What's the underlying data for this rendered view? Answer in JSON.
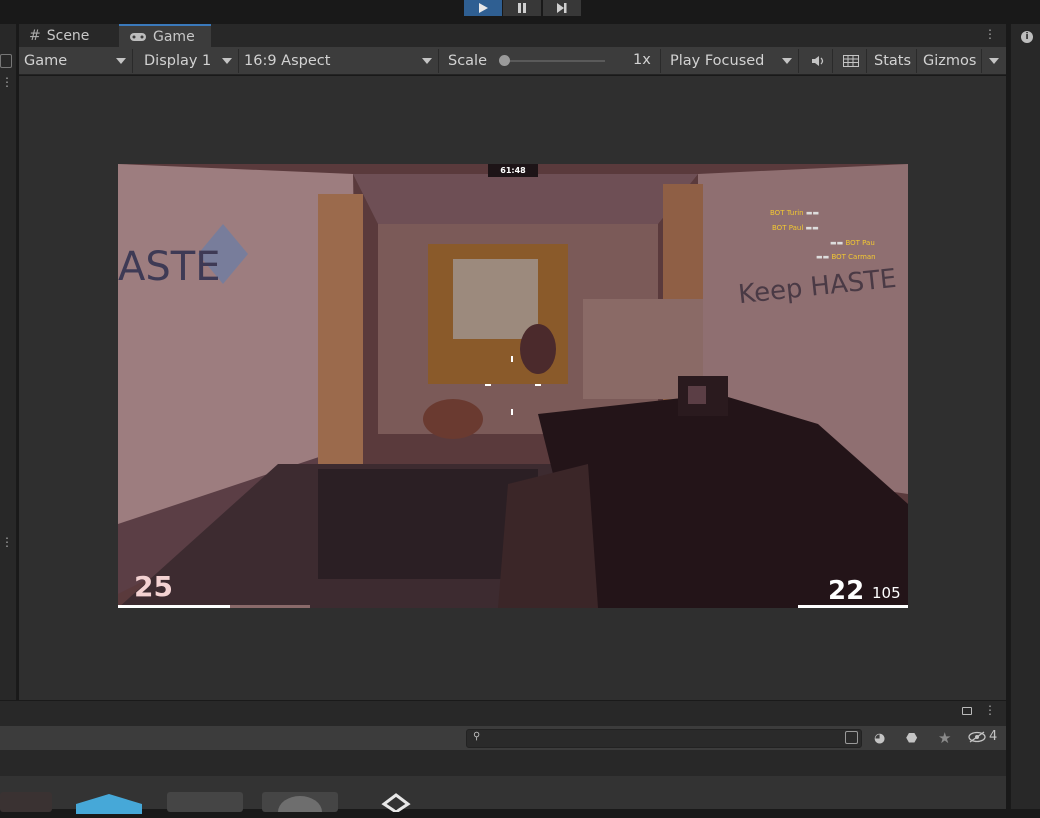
{
  "playbar": {
    "play_label": "Play",
    "pause_label": "Pause",
    "step_label": "Step"
  },
  "tabs": [
    {
      "label": "Scene",
      "icon": "hash-icon"
    },
    {
      "label": "Game",
      "icon": "gamepad-icon"
    }
  ],
  "toolbar": {
    "view_dropdown": "Game",
    "display_dropdown": "Display 1",
    "aspect_dropdown": "16:9 Aspect",
    "scale_label": "Scale",
    "scale_value": "1x",
    "scale_slider_fraction": 0,
    "play_mode_dropdown": "Play Focused",
    "stats_label": "Stats",
    "gizmos_label": "Gizmos"
  },
  "game": {
    "timer": "61:48",
    "wall_text_left": "ASTE",
    "wall_text_right": "Keep HASTE",
    "killfeed": [
      "BOT Turin",
      "BOT Paul",
      "BOT Pau",
      "BOT Carman"
    ],
    "health": "25",
    "ammo_clip": "22",
    "ammo_reserve": "105"
  },
  "project": {
    "search_value": "",
    "hidden_count": "4"
  },
  "colors": {
    "accent": "#3a79bb",
    "play_active": "#2f5f92",
    "killfeed_text": "#f2c832"
  }
}
